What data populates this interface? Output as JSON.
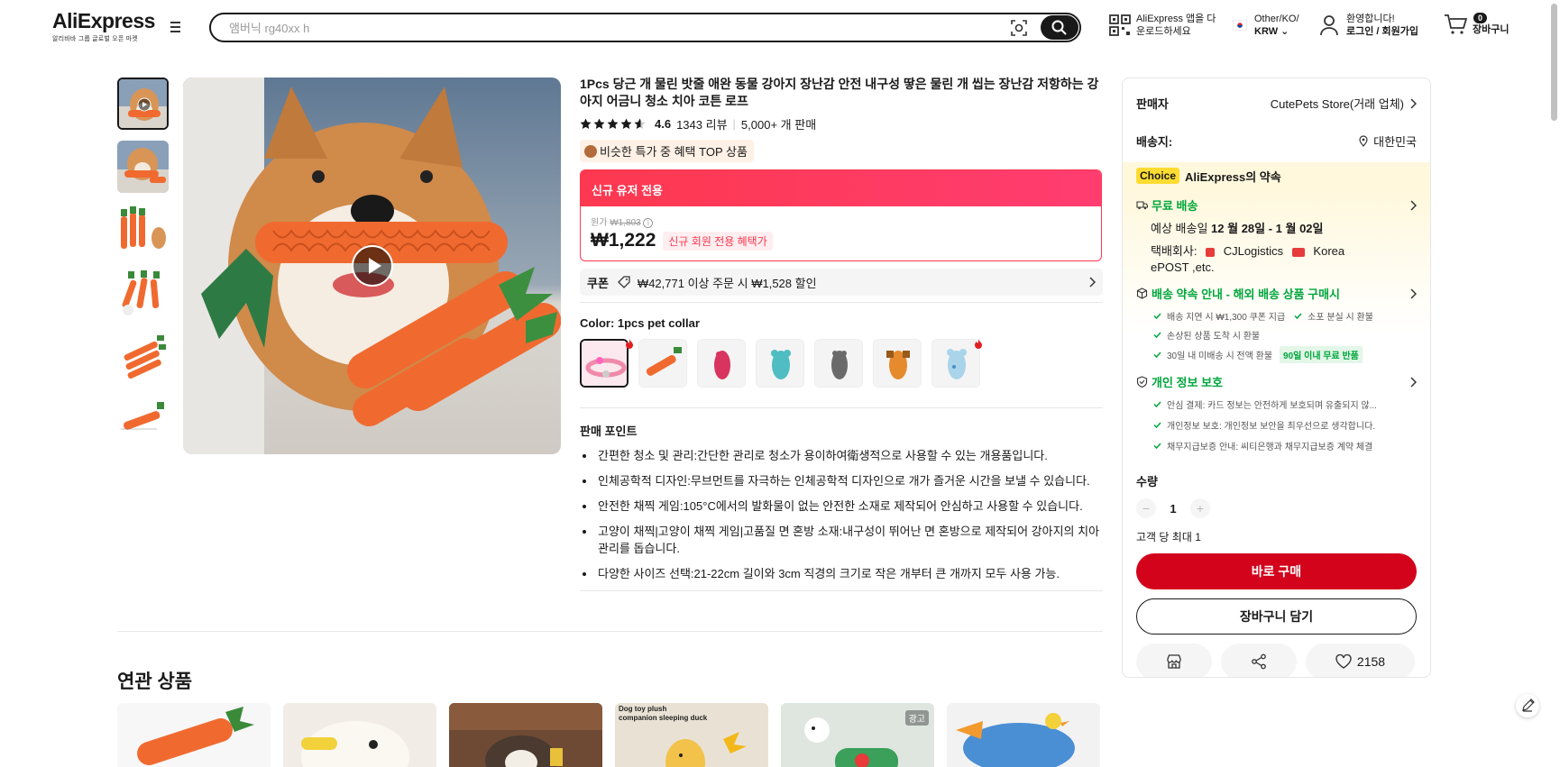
{
  "header": {
    "logo": "AliExpress",
    "logo_sub": "알리바바 그룹 글로벌 오픈 마켓",
    "search_placeholder": "앰버닉 rg40xx h",
    "app_download": "AliExpress 앱을 다\n운로드하세요",
    "app_line1": "AliExpress 앱을 다",
    "app_line2": "운로드하세요",
    "locale_line1": "Other/KO/",
    "locale_line2": "KRW",
    "user_line1": "환영합니다!",
    "user_line2": "로그인 / 회원가입",
    "cart_count": "0",
    "cart_label": "장바구니"
  },
  "product": {
    "title": "1Pcs 당근 개 물린 밧줄 애완 동물 강아지 장난감 안전 내구성 땋은 물린 개 씹는 장난감 저항하는 강아지 어금니 청소 치아 코튼 로프",
    "rating": "4.6",
    "reviews": "1343 리뷰",
    "sold": "5,000+ 개 판매",
    "deal_badge": "비슷한 특가 중 혜택 TOP 상품",
    "promo_header": "신규 유저 전용",
    "original_label": "원가",
    "original_price": "₩1,803",
    "price": "₩1,222",
    "new_user_tag": "신규 회원 전용 혜택가",
    "coupon_label": "쿠폰",
    "coupon_text": "₩42,771 이상 주문 시 ₩1,528 할인",
    "color_label": "Color: 1pcs pet collar",
    "selling_title": "판매 포인트",
    "selling_points": [
      "간편한 청소 및 관리:간단한 관리로 청소가 용이하여衛생적으로 사용할 수 있는 개용품입니다.",
      "인체공학적 디자인:무브먼트를 자극하는 인체공학적 디자인으로 개가 즐거운 시간을 보낼 수 있습니다.",
      "안전한 채찍 게임:105°C에서의 발화물이 없는 안전한 소재로 제작되어 안심하고 사용할 수 있습니다.",
      "고양이 채찍|고양이 채찍 게임|고품질 면 혼방 소재:내구성이 뛰어난 면 혼방으로 제작되어 강아지의 치아 관리를 돕습니다.",
      "다양한 사이즈 선택:21-22cm 길이와 3cm 직경의 크기로 작은 개부터 큰 개까지 모두 사용 가능."
    ]
  },
  "panel": {
    "seller_label": "판매자",
    "seller_name": "CutePets Store(거래 업체)",
    "ship_to_label": "배송지:",
    "ship_to": "대한민국",
    "choice_tag": "Choice",
    "choice_title": "AliExpress의 약속",
    "free_shipping": "무료 배송",
    "eta_prefix": "예상 배송일",
    "eta": "12 월 28일 - 1 월 02일",
    "carrier_label": "택배회사:",
    "carrier_1": "CJLogistics",
    "carrier_2": "Korea",
    "carrier_3": "ePOST ,etc.",
    "promise_title": "배송 약속 안내 - 해외 배송 상품 구매시",
    "promise_items": [
      "배송 지연 시 ₩1,300 쿠폰 지급",
      "소포 분실 시 환불",
      "손상된 상품 도착 시 환불",
      "30일 내 미배송 시 전액 환불"
    ],
    "free_return": "90일 이내 무료 반품",
    "privacy_title": "개인 정보 보호",
    "privacy_items": [
      "안심 결제: 카드 정보는 안전하게 보호되며 유출되지 않...",
      "개인정보 보호: 개인정보 보안을 최우선으로 생각합니다.",
      "채무지급보증 안내: 씨티은행과 채무지급보증 계약 체결"
    ],
    "qty_label": "수량",
    "qty_value": "1",
    "qty_minus": "−",
    "qty_plus": "+",
    "max_qty": "고객 당 최대 1",
    "buy_now": "바로 구매",
    "add_cart": "장바구니 담기",
    "wishlist_count": "2158"
  },
  "related": {
    "title": "연관 상품",
    "ad_tag": "광고",
    "duck_caption_1": "Dog toy plush",
    "duck_caption_2": "companion sleeping duck"
  },
  "colors": {
    "accent": "#fd384f",
    "buy": "#d3031c",
    "green": "#00a63c",
    "choice": "#fddc32"
  }
}
